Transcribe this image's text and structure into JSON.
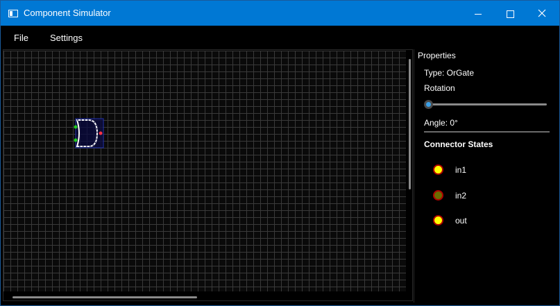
{
  "window": {
    "title": "Component Simulator"
  },
  "menu": {
    "file": "File",
    "settings": "Settings"
  },
  "properties": {
    "title": "Properties",
    "type_label": "Type: OrGate",
    "rotation_label": "Rotation",
    "rotation_value": 0,
    "angle_label": "Angle: 0°",
    "connector_title": "Connector States",
    "connectors": [
      {
        "name": "in1",
        "state_color": "#ffff00"
      },
      {
        "name": "in2",
        "state_color": "#6b6b00"
      },
      {
        "name": "out",
        "state_color": "#ffff00"
      }
    ]
  },
  "colors": {
    "accent": "#0078d4",
    "connector_ring": "#b00000",
    "input_pin": "#22cc22",
    "output_pin": "#ff3344",
    "slider_thumb": "#3aa0e8"
  }
}
